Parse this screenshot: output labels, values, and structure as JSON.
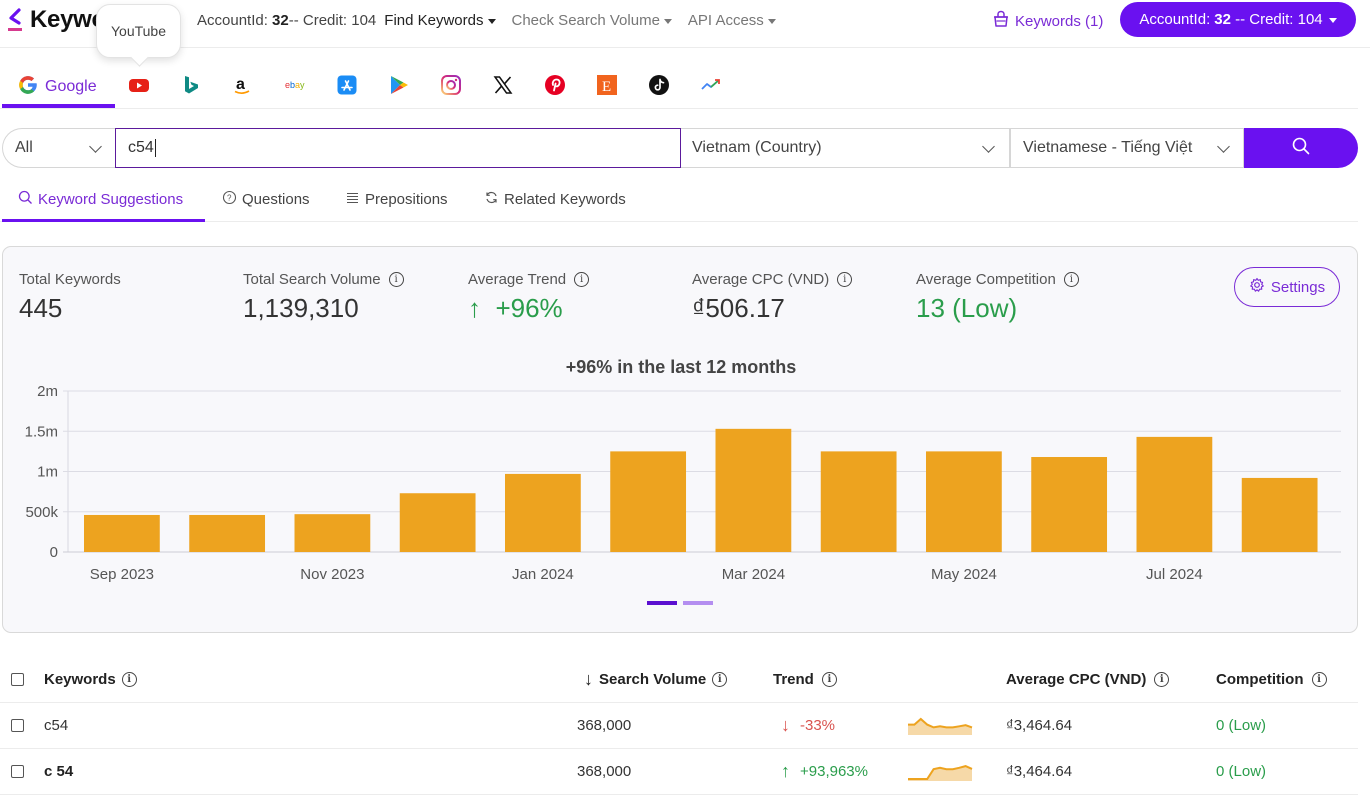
{
  "app": {
    "logo_text": "Keywo",
    "tooltip": "YouTube"
  },
  "topnav": {
    "account_label": "AccountId: ",
    "account_id": "32",
    "credit_text": "-- Credit: 104",
    "links": [
      {
        "label": "Find Keywords",
        "muted": false
      },
      {
        "label": "Check Search Volume",
        "muted": true
      },
      {
        "label": "API Access",
        "muted": true
      }
    ],
    "keywords_basket": "Keywords (1)",
    "account_pill_label": "AccountId: ",
    "account_pill_id": "32",
    "account_pill_credit": " -- Credit: 104"
  },
  "engines": {
    "active_label": "Google",
    "items": [
      "google",
      "youtube",
      "bing",
      "amazon",
      "ebay",
      "app-store",
      "google-play",
      "instagram",
      "x",
      "pinterest",
      "etsy",
      "tiktok",
      "trends"
    ]
  },
  "search": {
    "type_value": "All",
    "query": "c54",
    "country": "Vietnam (Country)",
    "language": "Vietnamese - Tiếng Việt"
  },
  "subtabs": [
    {
      "label": "Keyword Suggestions",
      "icon": "search-icon",
      "active": true
    },
    {
      "label": "Questions",
      "icon": "question-circle-icon",
      "active": false
    },
    {
      "label": "Prepositions",
      "icon": "list-icon",
      "active": false
    },
    {
      "label": "Related Keywords",
      "icon": "refresh-icon",
      "active": false
    }
  ],
  "summary": {
    "total_keywords_label": "Total Keywords",
    "total_keywords": "445",
    "total_volume_label": "Total Search Volume",
    "total_volume": "1,139,310",
    "avg_trend_label": "Average Trend",
    "avg_trend": "↑  +96%",
    "avg_cpc_label": "Average CPC (VND)",
    "avg_cpc": "₫506.17",
    "avg_comp_label": "Average Competition",
    "avg_comp": "13 (Low)",
    "settings_label": "Settings",
    "carousel_pages": 2,
    "carousel_active": 1
  },
  "chart_data": {
    "type": "bar",
    "title": "+96% in the last 12 months",
    "categories": [
      "Sep 2023",
      "Oct 2023",
      "Nov 2023",
      "Dec 2023",
      "Jan 2024",
      "Feb 2024",
      "Mar 2024",
      "Apr 2024",
      "May 2024",
      "Jun 2024",
      "Jul 2024",
      "Aug 2024"
    ],
    "values": [
      460000,
      460000,
      470000,
      730000,
      970000,
      1250000,
      1530000,
      1250000,
      1250000,
      1180000,
      1430000,
      920000
    ],
    "x_tick_labels": [
      "Sep 2023",
      "",
      "Nov 2023",
      "",
      "Jan 2024",
      "",
      "Mar 2024",
      "",
      "May 2024",
      "",
      "Jul 2024",
      ""
    ],
    "y_ticks": [
      0,
      500000,
      1000000,
      1500000,
      2000000
    ],
    "y_tick_labels": [
      "0",
      "500k",
      "1m",
      "1.5m",
      "2m"
    ],
    "ylim": [
      0,
      2000000
    ],
    "xlabel": "",
    "ylabel": "",
    "grid": true,
    "color": "#eda31f"
  },
  "table": {
    "headers": {
      "keyword": "Keywords",
      "volume": "Search Volume",
      "trend": "Trend",
      "cpc": "Average CPC (VND)",
      "competition": "Competition"
    },
    "sort_indicator": "↓",
    "rows": [
      {
        "keyword": "c54",
        "bold": false,
        "volume": "368,000",
        "trend": "-33%",
        "trend_dir": "down",
        "spark": [
          3,
          3,
          5,
          3,
          2,
          2.4,
          2,
          2,
          2.4,
          2.8,
          2
        ],
        "cpc": "₫3,464.64",
        "competition": "0 (Low)"
      },
      {
        "keyword": "c 54",
        "bold": true,
        "volume": "368,000",
        "trend": "+93,963%",
        "trend_dir": "up",
        "spark": [
          0,
          0,
          0,
          0,
          3.5,
          4,
          3.5,
          3.5,
          4,
          4.6,
          3.6
        ],
        "cpc": "₫3,464.64",
        "competition": "0 (Low)"
      }
    ]
  },
  "colors": {
    "accent": "#6a11f0",
    "accent_text": "#7a2bd6",
    "bar": "#eda31f",
    "up": "#2a9d4b",
    "down": "#d9534f"
  }
}
